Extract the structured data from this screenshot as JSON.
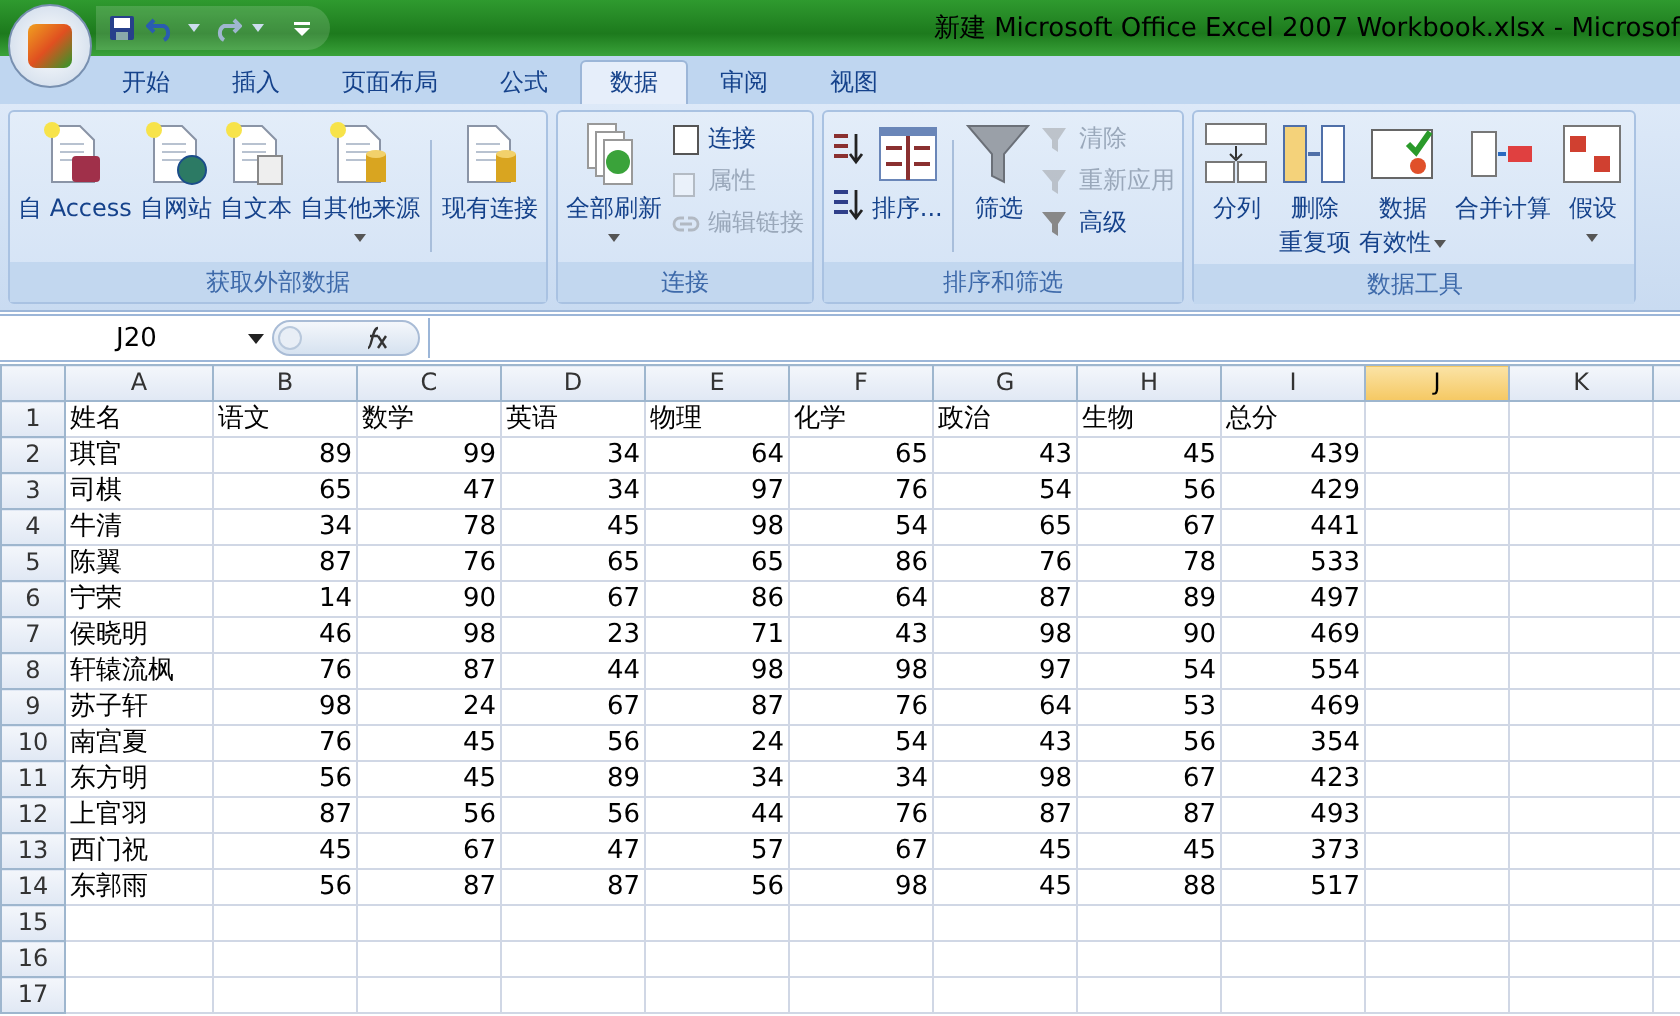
{
  "title_bar": {
    "title": "新建 Microsoft Office Excel 2007 Workbook.xlsx - Microsof"
  },
  "tabs": [
    {
      "label": "开始",
      "selected": false
    },
    {
      "label": "插入",
      "selected": false
    },
    {
      "label": "页面布局",
      "selected": false
    },
    {
      "label": "公式",
      "selected": false
    },
    {
      "label": "数据",
      "selected": true
    },
    {
      "label": "审阅",
      "selected": false
    },
    {
      "label": "视图",
      "selected": false
    }
  ],
  "ribbon_groups": [
    {
      "label": "获取外部数据",
      "items": [
        {
          "kind": "large",
          "lines": [
            "自 Access"
          ],
          "dropdown": false
        },
        {
          "kind": "large",
          "lines": [
            "自网站"
          ],
          "dropdown": false
        },
        {
          "kind": "large",
          "lines": [
            "自文本"
          ],
          "dropdown": false
        },
        {
          "kind": "large",
          "lines": [
            "自其他来源"
          ],
          "dropdown": true
        },
        {
          "kind": "separator"
        },
        {
          "kind": "large",
          "lines": [
            "现有连接"
          ],
          "dropdown": false
        }
      ]
    },
    {
      "label": "连接",
      "items": [
        {
          "kind": "large",
          "lines": [
            "全部刷新"
          ],
          "dropdown": true
        },
        {
          "kind": "stack",
          "items": [
            {
              "label": "连接",
              "disabled": false
            },
            {
              "label": "属性",
              "disabled": true
            },
            {
              "label": "编辑链接",
              "disabled": true
            }
          ]
        }
      ]
    },
    {
      "label": "排序和筛选",
      "items": [
        {
          "kind": "sort_stack"
        },
        {
          "kind": "large",
          "lines": [
            "排序..."
          ],
          "dropdown": false
        },
        {
          "kind": "separator"
        },
        {
          "kind": "large",
          "lines": [
            "筛选"
          ],
          "dropdown": false
        },
        {
          "kind": "stack",
          "items": [
            {
              "label": "清除",
              "disabled": true
            },
            {
              "label": "重新应用",
              "disabled": true
            },
            {
              "label": "高级",
              "disabled": false
            }
          ]
        }
      ]
    },
    {
      "label": "数据工具",
      "items": [
        {
          "kind": "large",
          "lines": [
            "分列"
          ],
          "dropdown": false
        },
        {
          "kind": "large",
          "lines": [
            "删除",
            "重复项"
          ],
          "dropdown": false
        },
        {
          "kind": "large",
          "lines": [
            "数据",
            "有效性"
          ],
          "dropdown": true
        },
        {
          "kind": "large",
          "lines": [
            "合并计算"
          ],
          "dropdown": false
        },
        {
          "kind": "large",
          "lines": [
            "假设"
          ],
          "dropdown": true
        }
      ]
    }
  ],
  "formula_bar": {
    "name_box": "J20"
  },
  "sheet": {
    "columns": [
      {
        "label": "A",
        "selected": false
      },
      {
        "label": "B",
        "selected": false
      },
      {
        "label": "C",
        "selected": false
      },
      {
        "label": "D",
        "selected": false
      },
      {
        "label": "E",
        "selected": false
      },
      {
        "label": "F",
        "selected": false
      },
      {
        "label": "G",
        "selected": false
      },
      {
        "label": "H",
        "selected": false
      },
      {
        "label": "I",
        "selected": false
      },
      {
        "label": "J",
        "selected": true
      },
      {
        "label": "K",
        "selected": false
      }
    ],
    "rows": [
      {
        "label": "1",
        "kind": "header",
        "cells": [
          "姓名",
          "语文",
          "数学",
          "英语",
          "物理",
          "化学",
          "政治",
          "生物",
          "总分"
        ]
      },
      {
        "label": "2",
        "kind": "data",
        "cells": [
          "琪官",
          "89",
          "99",
          "34",
          "64",
          "65",
          "43",
          "45",
          "439"
        ]
      },
      {
        "label": "3",
        "kind": "data",
        "cells": [
          "司棋",
          "65",
          "47",
          "34",
          "97",
          "76",
          "54",
          "56",
          "429"
        ]
      },
      {
        "label": "4",
        "kind": "data",
        "cells": [
          "牛清",
          "34",
          "78",
          "45",
          "98",
          "54",
          "65",
          "67",
          "441"
        ]
      },
      {
        "label": "5",
        "kind": "data",
        "cells": [
          "陈翼",
          "87",
          "76",
          "65",
          "65",
          "86",
          "76",
          "78",
          "533"
        ]
      },
      {
        "label": "6",
        "kind": "data",
        "cells": [
          "宁荣",
          "14",
          "90",
          "67",
          "86",
          "64",
          "87",
          "89",
          "497"
        ]
      },
      {
        "label": "7",
        "kind": "data",
        "cells": [
          "侯晓明",
          "46",
          "98",
          "23",
          "71",
          "43",
          "98",
          "90",
          "469"
        ]
      },
      {
        "label": "8",
        "kind": "data",
        "cells": [
          "轩辕流枫",
          "76",
          "87",
          "44",
          "98",
          "98",
          "97",
          "54",
          "554"
        ]
      },
      {
        "label": "9",
        "kind": "data",
        "cells": [
          "苏子轩",
          "98",
          "24",
          "67",
          "87",
          "76",
          "64",
          "53",
          "469"
        ]
      },
      {
        "label": "10",
        "kind": "data",
        "cells": [
          "南宫夏",
          "76",
          "45",
          "56",
          "24",
          "54",
          "43",
          "56",
          "354"
        ]
      },
      {
        "label": "11",
        "kind": "data",
        "cells": [
          "东方明",
          "56",
          "45",
          "89",
          "34",
          "34",
          "98",
          "67",
          "423"
        ]
      },
      {
        "label": "12",
        "kind": "data",
        "cells": [
          "上官羽",
          "87",
          "56",
          "56",
          "44",
          "76",
          "87",
          "87",
          "493"
        ]
      },
      {
        "label": "13",
        "kind": "data",
        "cells": [
          "西门祝",
          "45",
          "67",
          "47",
          "57",
          "67",
          "45",
          "45",
          "373"
        ]
      },
      {
        "label": "14",
        "kind": "data",
        "cells": [
          "东郭雨",
          "56",
          "87",
          "87",
          "56",
          "98",
          "45",
          "88",
          "517"
        ]
      },
      {
        "label": "15",
        "kind": "empty",
        "cells": []
      },
      {
        "label": "16",
        "kind": "empty",
        "cells": []
      },
      {
        "label": "17",
        "kind": "empty",
        "cells": []
      }
    ]
  }
}
